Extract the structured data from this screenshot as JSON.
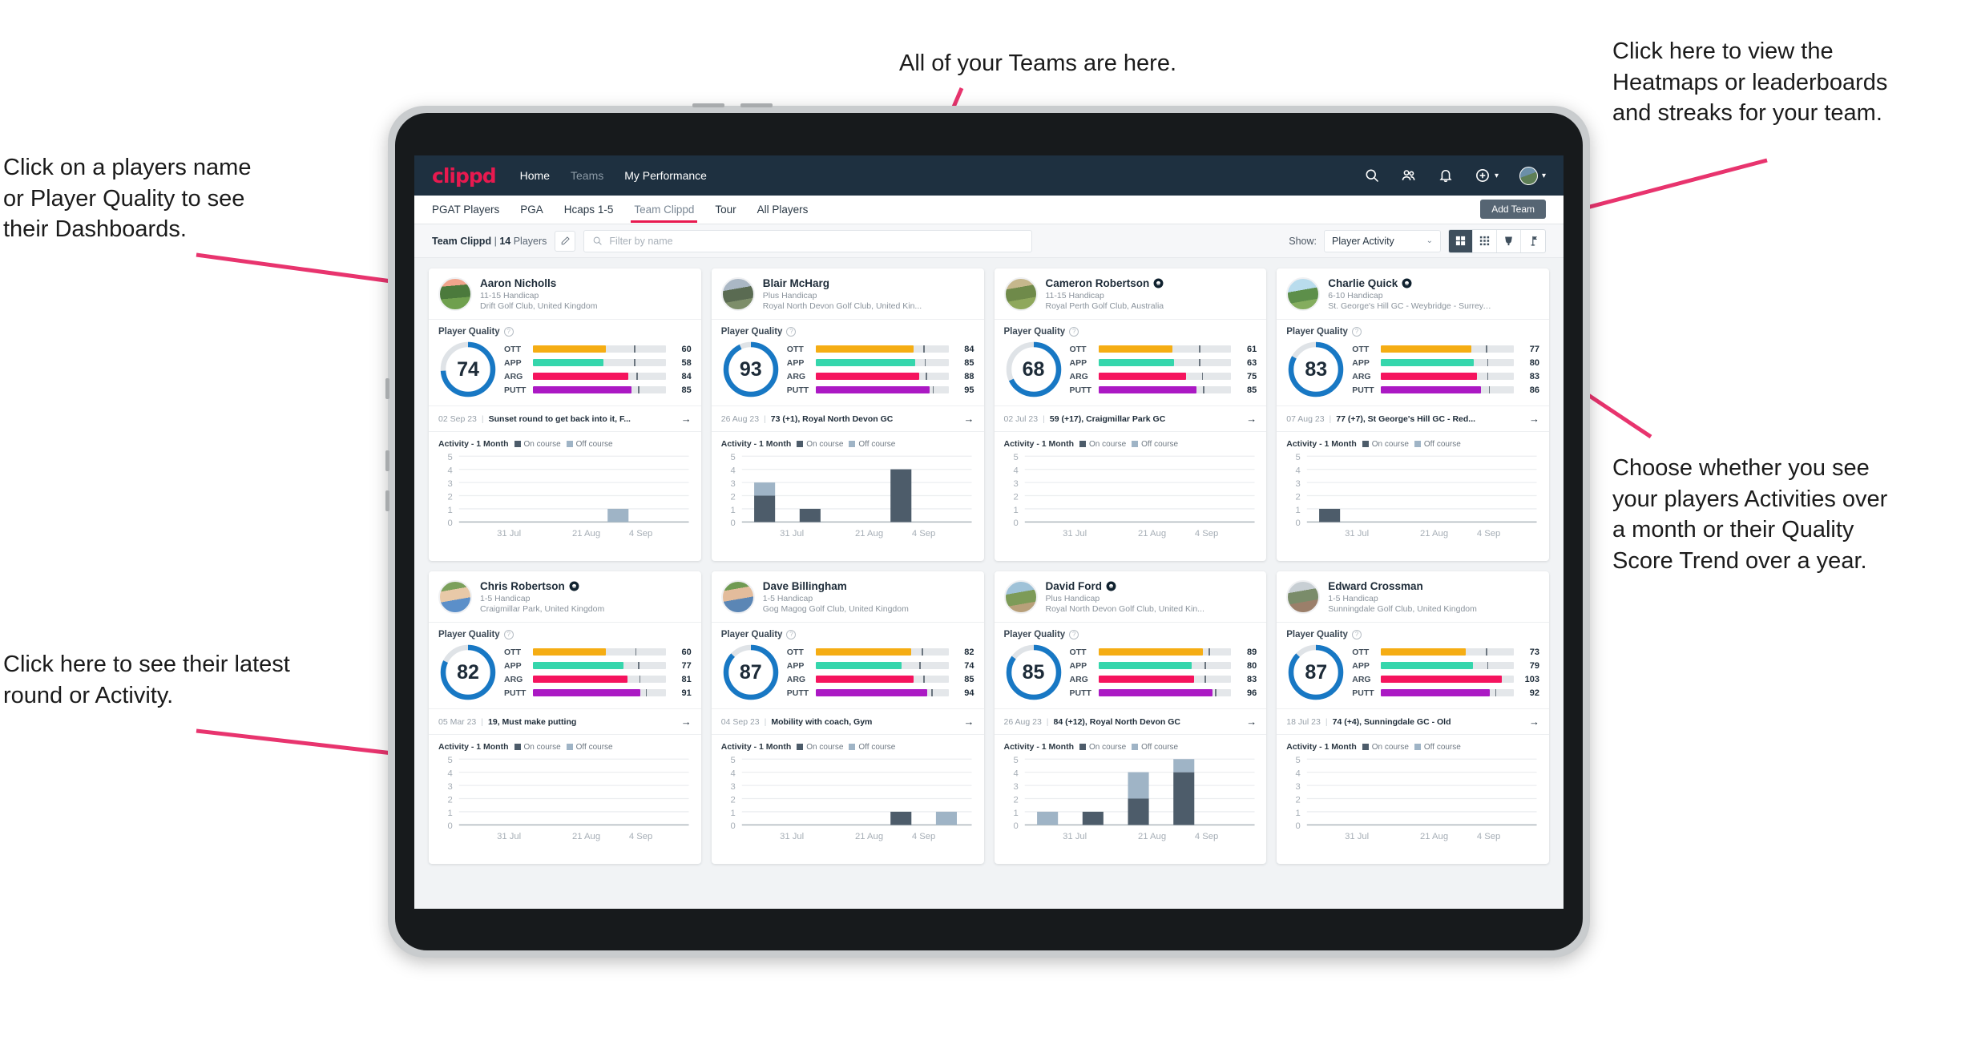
{
  "annotations": [
    {
      "id": "teams",
      "text": "All of your Teams are here."
    },
    {
      "id": "heatmaps",
      "text": "Click here to view the\nHeatmaps or leaderboards\nand streaks for your team."
    },
    {
      "id": "players-name",
      "text": "Click on a players name\nor Player Quality to see\ntheir Dashboards."
    },
    {
      "id": "activity-choice",
      "text": "Choose whether you see\nyour players Activities over\na month or their Quality\nScore Trend over a year."
    },
    {
      "id": "latest-round",
      "text": "Click here to see their latest\nround or Activity."
    }
  ],
  "navbar": {
    "logo": "clippd",
    "links": [
      {
        "label": "Home",
        "active": true
      },
      {
        "label": "Teams",
        "active": false
      },
      {
        "label": "My Performance",
        "active": true
      }
    ],
    "icons": [
      "search-icon",
      "people-icon",
      "bell-icon",
      "plus-circle-icon",
      "avatar"
    ]
  },
  "tabs": [
    {
      "label": "PGAT Players",
      "active": false
    },
    {
      "label": "PGA",
      "active": false
    },
    {
      "label": "Hcaps 1-5",
      "active": false
    },
    {
      "label": "Team Clippd",
      "active": true
    },
    {
      "label": "Tour",
      "active": false
    },
    {
      "label": "All Players",
      "active": false
    }
  ],
  "add_team_label": "Add Team",
  "filterbar": {
    "team_name": "Team Clippd",
    "team_sep": "|",
    "team_count": "14",
    "team_count_label": "Players",
    "edit_icon": "pencil-icon",
    "search_placeholder": "Filter by name",
    "show_label": "Show:",
    "show_value": "Player Activity",
    "view_modes": [
      "large-grid",
      "small-grid",
      "trophy",
      "flag"
    ],
    "view_active": 0
  },
  "card_labels": {
    "player_quality": "Player Quality",
    "activity": "Activity - 1 Month",
    "legend_on": "On course",
    "legend_off": "Off course",
    "metric_names": [
      "OTT",
      "APP",
      "ARG",
      "PUTT"
    ],
    "axis_y": [
      "5",
      "4",
      "3",
      "2",
      "1",
      "0"
    ],
    "axis_x": [
      "31 Jul",
      "21 Aug",
      "4 Sep"
    ]
  },
  "colors": {
    "accent": "#e8194f",
    "navbar": "#1e3040",
    "ring": "#1878c4",
    "ott": "#f5ad14",
    "app": "#35d6ac",
    "arg": "#f5145e",
    "putt": "#ab19c4",
    "on_course": "#4d5c6a",
    "off_course": "#9fb4c6"
  },
  "players": [
    {
      "name": "Aaron Nicholls",
      "verified": false,
      "handicap": "11-15 Handicap",
      "club": "Drift Golf Club, United Kingdom",
      "quality": 74,
      "metrics": [
        {
          "name": "OTT",
          "value": 60,
          "fill": 55,
          "tick": 76
        },
        {
          "name": "APP",
          "value": 58,
          "fill": 53,
          "tick": 76
        },
        {
          "name": "ARG",
          "value": 84,
          "fill": 72,
          "tick": 78
        },
        {
          "name": "PUTT",
          "value": 85,
          "fill": 74,
          "tick": 79
        }
      ],
      "latest_date": "02 Sep 23",
      "latest_text": "Sunset round to get back into it, F...",
      "avatar_css": "linear-gradient(175deg,#f0a48c 0 24%,#4b7a3c 24% 62%,#6fa04e 62% 100%)",
      "bars": [
        {
          "on": 0,
          "off": 0
        },
        {
          "on": 0,
          "off": 0
        },
        {
          "on": 0,
          "off": 0
        },
        {
          "on": 0,
          "off": 1
        },
        {
          "on": 0,
          "off": 0
        }
      ]
    },
    {
      "name": "Blair McHarg",
      "verified": false,
      "handicap": "Plus Handicap",
      "club": "Royal North Devon Golf Club, United Kin...",
      "quality": 93,
      "metrics": [
        {
          "name": "OTT",
          "value": 84,
          "fill": 74,
          "tick": 81
        },
        {
          "name": "APP",
          "value": 85,
          "fill": 75,
          "tick": 82
        },
        {
          "name": "ARG",
          "value": 88,
          "fill": 78,
          "tick": 83
        },
        {
          "name": "PUTT",
          "value": 95,
          "fill": 86,
          "tick": 88
        }
      ],
      "latest_date": "26 Aug 23",
      "latest_text": "73 (+1), Royal North Devon GC",
      "avatar_css": "linear-gradient(170deg,#aab7c4 0 34%,#5a6b52 34% 68%,#7d8e6a 68% 100%)",
      "bars": [
        {
          "on": 2,
          "off": 1
        },
        {
          "on": 1,
          "off": 0
        },
        {
          "on": 0,
          "off": 0
        },
        {
          "on": 4,
          "off": 0
        },
        {
          "on": 0,
          "off": 0
        }
      ]
    },
    {
      "name": "Cameron Robertson",
      "verified": true,
      "handicap": "11-15 Handicap",
      "club": "Royal Perth Golf Club, Australia",
      "quality": 68,
      "metrics": [
        {
          "name": "OTT",
          "value": 61,
          "fill": 56,
          "tick": 76
        },
        {
          "name": "APP",
          "value": 63,
          "fill": 57,
          "tick": 76
        },
        {
          "name": "ARG",
          "value": 75,
          "fill": 66,
          "tick": 78
        },
        {
          "name": "PUTT",
          "value": 85,
          "fill": 74,
          "tick": 79
        }
      ],
      "latest_date": "02 Jul 23",
      "latest_text": "59 (+17), Craigmillar Park GC",
      "avatar_css": "linear-gradient(170deg,#c5b78c 0 30%,#6f8a4a 30% 65%,#8fa85c 65% 100%)",
      "bars": [
        {
          "on": 0,
          "off": 0
        },
        {
          "on": 0,
          "off": 0
        },
        {
          "on": 0,
          "off": 0
        },
        {
          "on": 0,
          "off": 0
        },
        {
          "on": 0,
          "off": 0
        }
      ]
    },
    {
      "name": "Charlie Quick",
      "verified": true,
      "handicap": "6-10 Handicap",
      "club": "St. George's Hill GC - Weybridge - Surrey, ...",
      "quality": 83,
      "metrics": [
        {
          "name": "OTT",
          "value": 77,
          "fill": 68,
          "tick": 79
        },
        {
          "name": "APP",
          "value": 80,
          "fill": 70,
          "tick": 80
        },
        {
          "name": "ARG",
          "value": 83,
          "fill": 72,
          "tick": 80
        },
        {
          "name": "PUTT",
          "value": 86,
          "fill": 75,
          "tick": 81
        }
      ],
      "latest_date": "07 Aug 23",
      "latest_text": "77 (+7), St George's Hill GC - Red...",
      "avatar_css": "linear-gradient(170deg,#b9dced 0 38%,#5d8f4a 38% 70%,#84ad5e 70% 100%)",
      "bars": [
        {
          "on": 1,
          "off": 0
        },
        {
          "on": 0,
          "off": 0
        },
        {
          "on": 0,
          "off": 0
        },
        {
          "on": 0,
          "off": 0
        },
        {
          "on": 0,
          "off": 0
        }
      ]
    },
    {
      "name": "Chris Robertson",
      "verified": true,
      "handicap": "1-5 Handicap",
      "club": "Craigmillar Park, United Kingdom",
      "quality": 82,
      "metrics": [
        {
          "name": "OTT",
          "value": 60,
          "fill": 55,
          "tick": 77
        },
        {
          "name": "APP",
          "value": 77,
          "fill": 68,
          "tick": 79
        },
        {
          "name": "ARG",
          "value": 81,
          "fill": 71,
          "tick": 80
        },
        {
          "name": "PUTT",
          "value": 91,
          "fill": 81,
          "tick": 85
        }
      ],
      "latest_date": "05 Mar 23",
      "latest_text": "19, Must make putting",
      "avatar_css": "linear-gradient(170deg,#7ba05c 0 28%,#e8c9a8 28% 58%,#5b8fc9 58% 100%)",
      "bars": [
        {
          "on": 0,
          "off": 0
        },
        {
          "on": 0,
          "off": 0
        },
        {
          "on": 0,
          "off": 0
        },
        {
          "on": 0,
          "off": 0
        },
        {
          "on": 0,
          "off": 0
        }
      ]
    },
    {
      "name": "Dave Billingham",
      "verified": false,
      "handicap": "1-5 Handicap",
      "club": "Gog Magog Golf Club, United Kingdom",
      "quality": 87,
      "metrics": [
        {
          "name": "OTT",
          "value": 82,
          "fill": 72,
          "tick": 80
        },
        {
          "name": "APP",
          "value": 74,
          "fill": 65,
          "tick": 78
        },
        {
          "name": "ARG",
          "value": 85,
          "fill": 74,
          "tick": 81
        },
        {
          "name": "PUTT",
          "value": 94,
          "fill": 84,
          "tick": 87
        }
      ],
      "latest_date": "04 Sep 23",
      "latest_text": "Mobility with coach, Gym",
      "avatar_css": "linear-gradient(170deg,#6f9a52 0 26%,#e3bc9c 26% 56%,#5b86b5 56% 100%)",
      "bars": [
        {
          "on": 0,
          "off": 0
        },
        {
          "on": 0,
          "off": 0
        },
        {
          "on": 0,
          "off": 0
        },
        {
          "on": 1,
          "off": 0
        },
        {
          "on": 0,
          "off": 1
        }
      ]
    },
    {
      "name": "David Ford",
      "verified": true,
      "handicap": "Plus Handicap",
      "club": "Royal North Devon Golf Club, United Kin...",
      "quality": 85,
      "metrics": [
        {
          "name": "OTT",
          "value": 89,
          "fill": 79,
          "tick": 83
        },
        {
          "name": "APP",
          "value": 80,
          "fill": 70,
          "tick": 80
        },
        {
          "name": "ARG",
          "value": 83,
          "fill": 72,
          "tick": 80
        },
        {
          "name": "PUTT",
          "value": 96,
          "fill": 86,
          "tick": 88
        }
      ],
      "latest_date": "26 Aug 23",
      "latest_text": "84 (+12), Royal North Devon GC",
      "avatar_css": "linear-gradient(170deg,#9fc2d8 0 36%,#7d9b58 36% 70%,#b8a07a 70% 100%)",
      "bars": [
        {
          "on": 0,
          "off": 1
        },
        {
          "on": 1,
          "off": 0
        },
        {
          "on": 2,
          "off": 2
        },
        {
          "on": 4,
          "off": 1
        },
        {
          "on": 0,
          "off": 0
        }
      ]
    },
    {
      "name": "Edward Crossman",
      "verified": false,
      "handicap": "1-5 Handicap",
      "club": "Sunningdale Golf Club, United Kingdom",
      "quality": 87,
      "metrics": [
        {
          "name": "OTT",
          "value": 73,
          "fill": 64,
          "tick": 79
        },
        {
          "name": "APP",
          "value": 79,
          "fill": 69,
          "tick": 80
        },
        {
          "name": "ARG",
          "value": 103,
          "fill": 91,
          "tick": 0
        },
        {
          "name": "PUTT",
          "value": 92,
          "fill": 82,
          "tick": 86
        }
      ],
      "latest_date": "18 Jul 23",
      "latest_text": "74 (+4), Sunningdale GC - Old",
      "avatar_css": "linear-gradient(170deg,#c8cfd4 0 32%,#7a8c6a 32% 64%,#9b7f6a 64% 100%)",
      "bars": [
        {
          "on": 0,
          "off": 0
        },
        {
          "on": 0,
          "off": 0
        },
        {
          "on": 0,
          "off": 0
        },
        {
          "on": 0,
          "off": 0
        },
        {
          "on": 0,
          "off": 0
        }
      ]
    }
  ]
}
